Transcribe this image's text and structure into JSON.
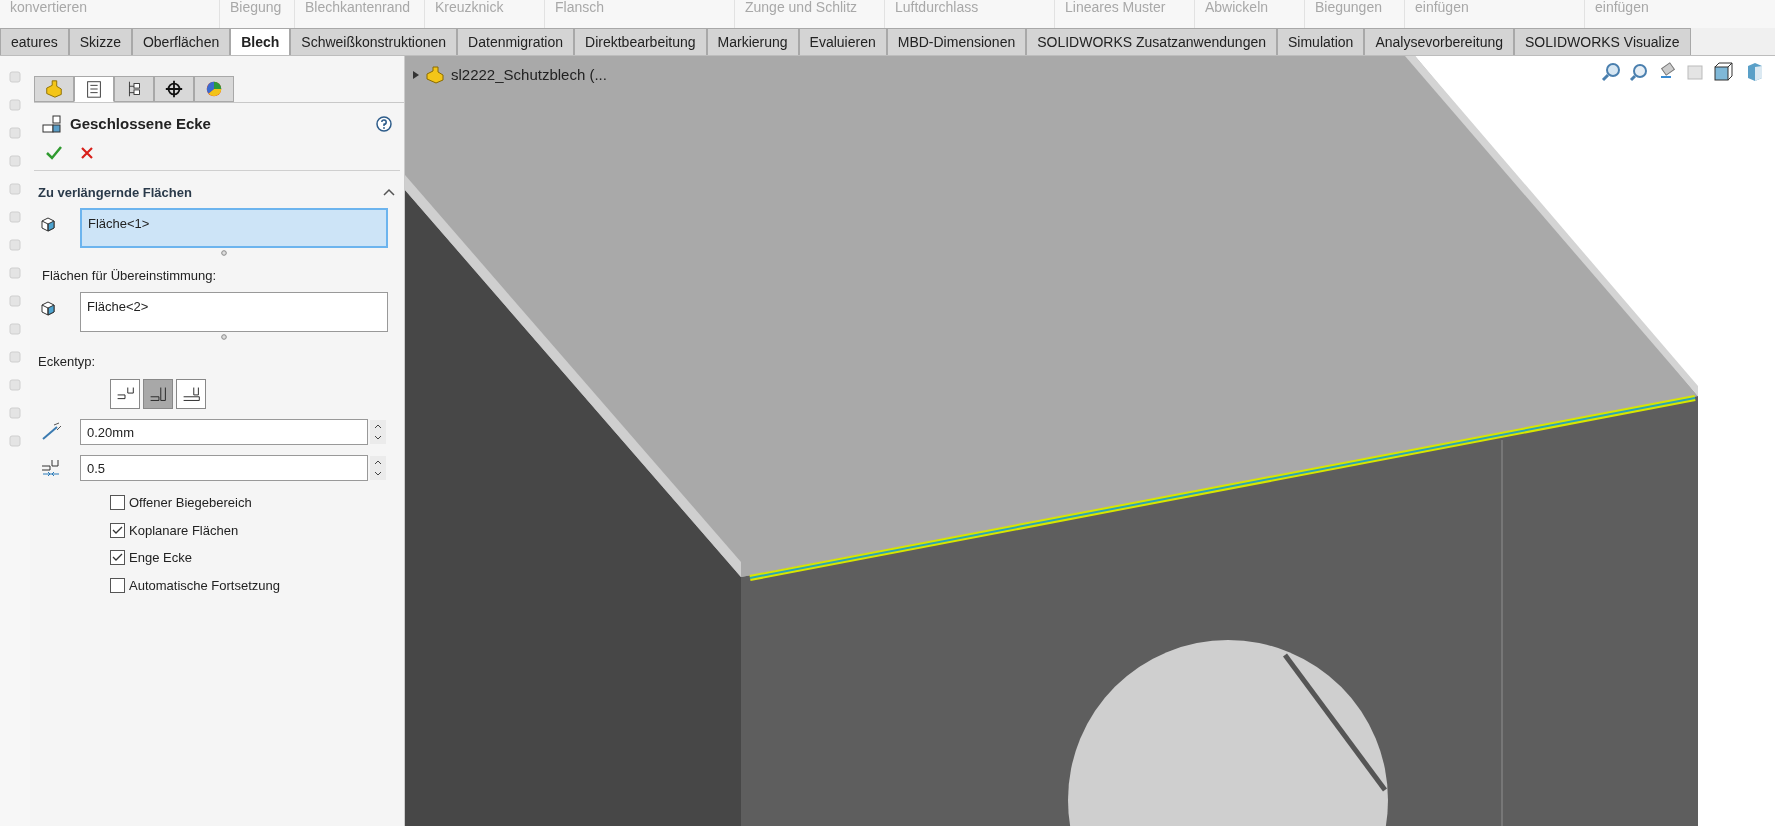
{
  "ribbon_commands": [
    "konvertieren",
    "Biegung",
    "Blechkantenrand",
    "Kreuzknick",
    "Flansch",
    "Zunge und Schlitz",
    "Luftdurchlass",
    "Lineares Muster",
    "Abwickeln",
    "Biegungen",
    "einfügen",
    "einfügen"
  ],
  "tabs": [
    {
      "label": "eatures",
      "selected": false
    },
    {
      "label": "Skizze",
      "selected": false
    },
    {
      "label": "Oberflächen",
      "selected": false
    },
    {
      "label": "Blech",
      "selected": true
    },
    {
      "label": "Schweißkonstruktionen",
      "selected": false
    },
    {
      "label": "Datenmigration",
      "selected": false
    },
    {
      "label": "Direktbearbeitung",
      "selected": false
    },
    {
      "label": "Markierung",
      "selected": false
    },
    {
      "label": "Evaluieren",
      "selected": false
    },
    {
      "label": "MBD-Dimensionen",
      "selected": false
    },
    {
      "label": "SOLIDWORKS Zusatzanwendungen",
      "selected": false
    },
    {
      "label": "Simulation",
      "selected": false
    },
    {
      "label": "Analysevorbereitung",
      "selected": false
    },
    {
      "label": "SOLIDWORKS Visualize",
      "selected": false
    }
  ],
  "property_manager": {
    "panel_tabs": [
      {
        "kind": "part",
        "selected": false
      },
      {
        "kind": "properties",
        "selected": true
      },
      {
        "kind": "configuration",
        "selected": false
      },
      {
        "kind": "target",
        "selected": false
      },
      {
        "kind": "appearance",
        "selected": false
      }
    ],
    "title": "Geschlossene Ecke",
    "section": {
      "title": "Zu verlängernde Flächen",
      "expanded": true
    },
    "faces_to_extend": {
      "value": "Fläche<1>",
      "active": true
    },
    "match_label": "Flächen für Übereinstimmung:",
    "faces_to_match": {
      "value": "Fläche<2>",
      "active": false
    },
    "corner_type_label": "Eckentyp:",
    "corner_types": [
      {
        "selected": false
      },
      {
        "selected": true
      },
      {
        "selected": false
      }
    ],
    "gap_distance": "0.20mm",
    "overlap_ratio": "0.5",
    "options": [
      {
        "label": "Offener Biegebereich",
        "checked": false
      },
      {
        "label": "Koplanare Flächen",
        "checked": true
      },
      {
        "label": "Enge Ecke",
        "checked": true
      },
      {
        "label": "Automatische Fortsetzung",
        "checked": false
      }
    ]
  },
  "viewport": {
    "tree_item": "sl2222_Schutzblech (..."
  }
}
